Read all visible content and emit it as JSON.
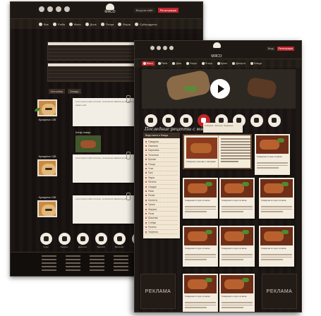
{
  "back": {
    "logo_text": "МЯСО",
    "login": {
      "enter": "Вход на сайт",
      "register": "Регистрация"
    },
    "nav": [
      "Все",
      "Рыба",
      "Мясо",
      "Дичь",
      "Птица",
      "Фарш",
      "Субпродукты",
      "Блюда"
    ],
    "tag_labels": [
      "Источник",
      "Блюдо"
    ],
    "reviews": [
      {
        "user": "Кукарача 138",
        "text": "Lorem ipsum dolor sit amet, consectetur adipiscing elit. Morbi porta sapien velit."
      },
      {
        "user": "Кукарача 138",
        "text": "Lorem ipsum dolor sit amet, consectetur adipiscing elit."
      },
      {
        "user": "Кукарача 138",
        "text": "Lorem ipsum dolor sit amet, consectetur adipiscing elit."
      }
    ],
    "mini_title": "Шеф-повар",
    "icon_labels": [
      "Супы",
      "Салаты",
      "Десерты",
      "Закуски",
      "Выпечка",
      "Соусы"
    ]
  },
  "front": {
    "logo_text": "МЯСО",
    "login": {
      "enter": "Вход",
      "register": "Регистрация"
    },
    "nav": [
      {
        "label": "Мясо",
        "active": true
      },
      {
        "label": "Рыба",
        "active": false
      },
      {
        "label": "Дичь",
        "active": false
      },
      {
        "label": "Фарш",
        "active": false
      },
      {
        "label": "Птица",
        "active": false
      },
      {
        "label": "Кухни",
        "active": false
      },
      {
        "label": "Десерты",
        "active": false
      },
      {
        "label": "Блюда",
        "active": false
      }
    ],
    "section_title": "Последние рецепты с мясом",
    "dropdown": [
      "Говядина",
      "Свинина",
      "Баранина"
    ],
    "sidebar": {
      "head": "Виды мяса и блюда",
      "items": [
        "Говядина",
        "Свинина",
        "Баранина",
        "Телятина",
        "Кролик",
        "Птица",
        "Утка",
        "Гусь",
        "Фарш",
        "Печень",
        "Сердце",
        "Язык",
        "Почки",
        "Котлеты",
        "Гуляш",
        "Жаркое",
        "Плов",
        "Шашлык",
        "Стейки",
        "Рулеты",
        "Тефтели",
        "Прочее"
      ]
    },
    "featured_title": "Говядина тушеная с овощами",
    "card_title": "Говядина в соусе из вина",
    "ad_label": "РЕКЛАМА"
  }
}
